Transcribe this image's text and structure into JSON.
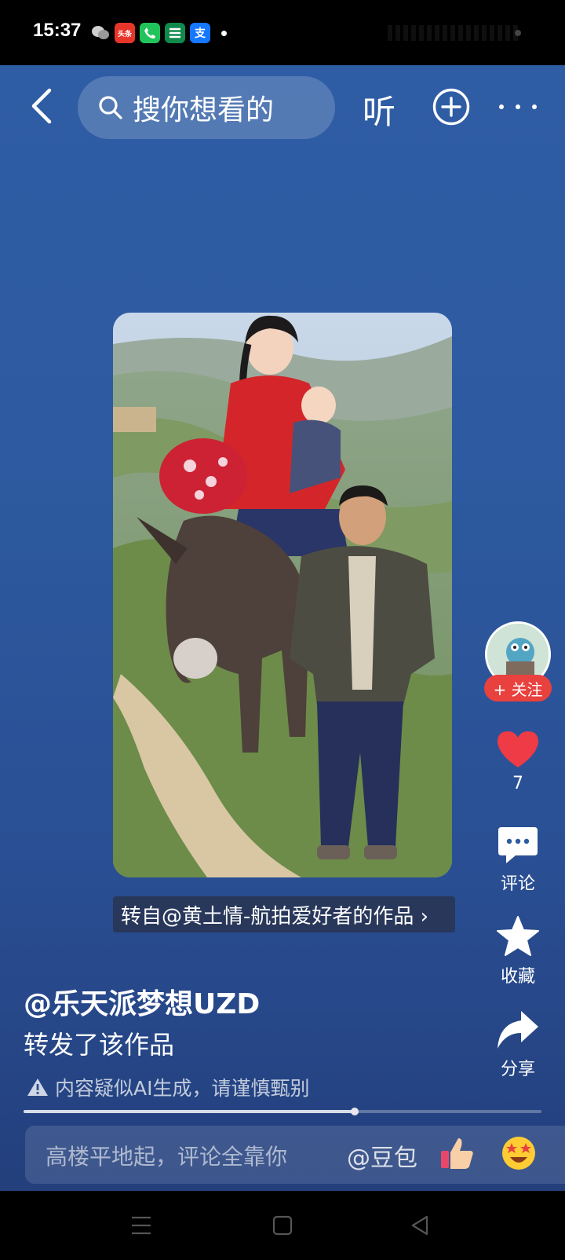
{
  "status_bar": {
    "time": "15:37",
    "toutiao_icon_text": "头条",
    "alipay_icon_text": "支"
  },
  "topbar": {
    "search_placeholder": "搜你想看的",
    "listen_label": "听"
  },
  "video": {
    "source_tag": "转自@黄土情-航拍爱好者的作品 ›"
  },
  "side_actions": {
    "follow_label": "+ 关注",
    "like_count": "7",
    "comment_label": "评论",
    "favorite_label": "收藏",
    "share_label": "分享"
  },
  "post": {
    "author": "@乐天派梦想UZD",
    "action_text": "转发了该作品",
    "ai_warning": "内容疑似AI生成，请谨慎甄别"
  },
  "playback": {
    "progress": 0.64
  },
  "comment_bar": {
    "placeholder": "高楼平地起，评论全靠你",
    "mention": "@豆包"
  },
  "colors": {
    "background_top": "#2f5da5",
    "background_bottom": "#233f7c",
    "follow_red": "#e8413e",
    "like_red": "#ee3b45"
  },
  "icons": {
    "back": "chevron-left-icon",
    "search": "search-icon",
    "add": "plus-circle-icon",
    "more": "more-icon",
    "like": "heart-icon",
    "comment": "comment-bubble-icon",
    "favorite": "star-icon",
    "share": "share-arrow-icon",
    "warning": "warning-triangle-icon",
    "thumbs_up": "thumbs-up-emoji",
    "star_eyes": "star-eyes-emoji"
  }
}
